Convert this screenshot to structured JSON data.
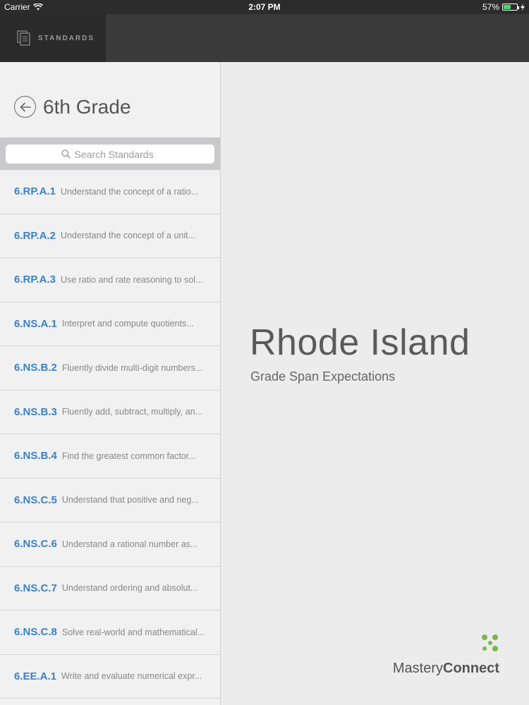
{
  "status": {
    "carrier": "Carrier",
    "time": "2:07 PM",
    "battery": "57%",
    "battery_level": 0.57
  },
  "nav": {
    "tab_label": "STANDARDS"
  },
  "sidebar": {
    "title": "6th Grade",
    "search_placeholder": "Search Standards",
    "items": [
      {
        "code": "6.RP.A.1",
        "desc": "Understand the concept of a ratio..."
      },
      {
        "code": "6.RP.A.2",
        "desc": "Understand the concept of a unit..."
      },
      {
        "code": "6.RP.A.3",
        "desc": "Use ratio and rate reasoning to sol..."
      },
      {
        "code": "6.NS.A.1",
        "desc": "Interpret and compute quotients..."
      },
      {
        "code": "6.NS.B.2",
        "desc": "Fluently divide multi-digit numbers..."
      },
      {
        "code": "6.NS.B.3",
        "desc": "Fluently add, subtract, multiply, an..."
      },
      {
        "code": "6.NS.B.4",
        "desc": "Find the greatest common factor..."
      },
      {
        "code": "6.NS.C.5",
        "desc": "Understand that positive and neg..."
      },
      {
        "code": "6.NS.C.6",
        "desc": "Understand a rational number as..."
      },
      {
        "code": "6.NS.C.7",
        "desc": "Understand ordering and absolut..."
      },
      {
        "code": "6.NS.C.8",
        "desc": "Solve real-world and mathematical..."
      },
      {
        "code": "6.EE.A.1",
        "desc": "Write and evaluate numerical expr..."
      }
    ]
  },
  "main": {
    "title": "Rhode Island",
    "subtitle": "Grade Span Expectations",
    "brand_light": "Mastery",
    "brand_bold": "Connect",
    "brand_color": "#7ab648"
  },
  "colors": {
    "accent": "#3b82c4",
    "nav_bg": "#3a3a3a",
    "nav_active": "#2a2a2a"
  },
  "icons": {
    "wifi": "wifi-icon",
    "standards": "document-stack-icon",
    "back": "back-arrow-icon",
    "search": "search-icon"
  }
}
